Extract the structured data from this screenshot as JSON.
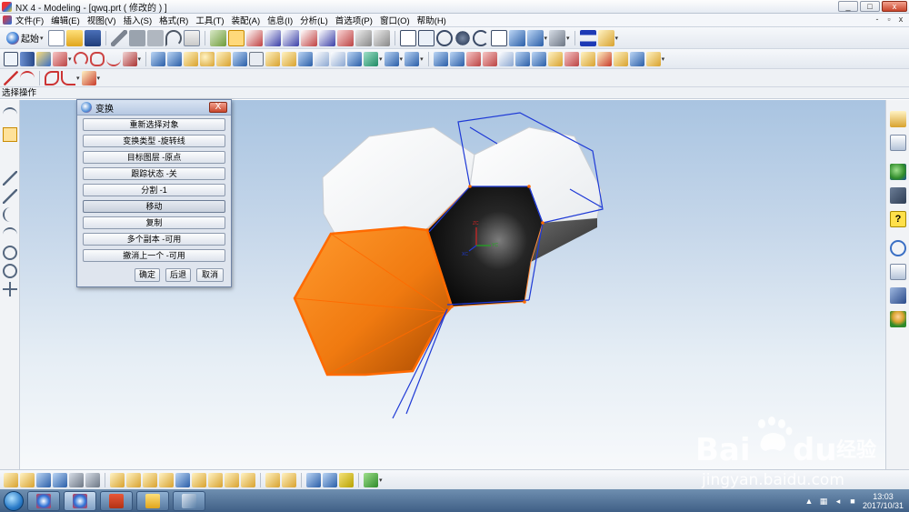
{
  "window": {
    "title": "NX 4 - Modeling - [qwq.prt  ( 修改的 ) ]",
    "min_label": "_",
    "max_label": "□",
    "close_label": "x"
  },
  "menu": {
    "items": [
      "文件(F)",
      "编辑(E)",
      "视图(V)",
      "插入(S)",
      "格式(R)",
      "工具(T)",
      "装配(A)",
      "信息(I)",
      "分析(L)",
      "首选项(P)",
      "窗口(O)",
      "帮助(H)"
    ],
    "mdi_min": "-",
    "mdi_restore": "▫",
    "mdi_close": "x"
  },
  "toolbar": {
    "start_label": "起始",
    "start_icon": "nx-start-icon"
  },
  "status": {
    "prompt": "选择操作"
  },
  "dialog": {
    "title": "变换",
    "close_label": "X",
    "buttons": [
      "重新选择对象",
      "变换类型 -旋转线",
      "目标图层 -原点",
      "跟踪状态 -关",
      "分割 -1",
      "移动",
      "复制",
      "多个副本 -可用",
      "撤消上一个 -可用"
    ],
    "pressed_index": 5,
    "ok_label": "确定",
    "back_label": "后退",
    "cancel_label": "取消"
  },
  "csys": {
    "xc": "XC",
    "yc": "YC",
    "zc": "ZC"
  },
  "taskbar": {
    "time": "13:03",
    "date": "2017/10/31",
    "tray_icons": [
      "show-hidden-icon",
      "network-icon",
      "volume-icon",
      "input-method-icon"
    ]
  },
  "watermark": {
    "url": "jingyan.baidu.com"
  },
  "colors": {
    "orange_face": "#f07a10",
    "white_face": "#ffffff",
    "black_face": "#0a0a0a",
    "selection_blue": "#1f3ad6",
    "viewport_top": "#a9c4e1",
    "viewport_bottom": "#f7f9fb"
  }
}
